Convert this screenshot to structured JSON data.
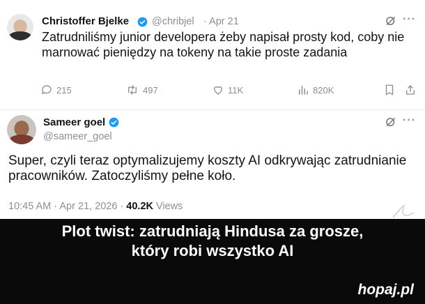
{
  "tweet1": {
    "author_name": "Christoffer Bjelke",
    "handle": "@chribjel",
    "date": "· Apr 21",
    "text": "Zatrudniliśmy junior developera żeby napisał prosty kod, coby nie marnować pieniędzy na tokeny na takie proste zadania",
    "replies": "215",
    "retweets": "497",
    "likes": "11K",
    "views": "820K"
  },
  "tweet2": {
    "author_name": "Sameer goel",
    "handle": "@sameer_goel",
    "text": "Super, czyli teraz optymalizujemy koszty AI odkrywając zatrudnianie pracowników. Zatoczyliśmy pełne koło.",
    "time": "10:45 AM · Apr 21, 2026 ·",
    "views_count": "40.2K",
    "views_label": "Views"
  },
  "caption": {
    "line1": "Plot twist: zatrudniają Hindusa za grosze,",
    "line2": "który robi wszystko AI"
  },
  "watermark": "hopaj.pl",
  "colors": {
    "verified": "#1d9bf0",
    "text": "#0f1419",
    "muted": "#8a8f94",
    "caption_bg": "#0a0a0a"
  },
  "icons": [
    "grok-icon",
    "more-icon",
    "reply-icon",
    "retweet-icon",
    "like-icon",
    "views-icon",
    "bookmark-icon",
    "share-icon",
    "verified-icon"
  ]
}
